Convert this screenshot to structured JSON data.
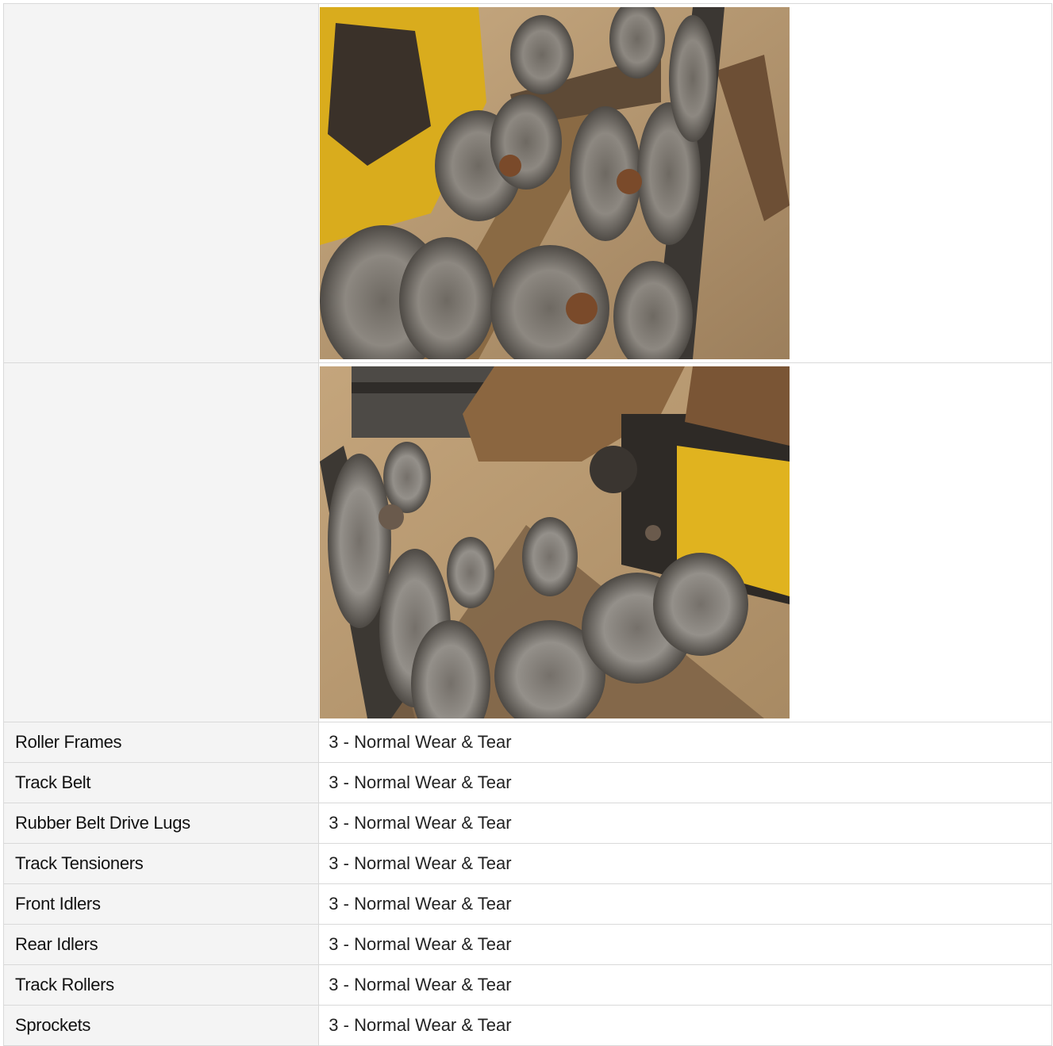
{
  "photos": [
    {
      "icon": "undercarriage-photo-roller-wheels-left"
    },
    {
      "icon": "undercarriage-photo-roller-wheels-right"
    }
  ],
  "rows": [
    {
      "label": "Roller Frames",
      "value": "3 - Normal Wear & Tear"
    },
    {
      "label": "Track Belt",
      "value": "3 - Normal Wear & Tear"
    },
    {
      "label": "Rubber Belt Drive Lugs",
      "value": "3 - Normal Wear & Tear"
    },
    {
      "label": "Track Tensioners",
      "value": "3 - Normal Wear & Tear"
    },
    {
      "label": "Front Idlers",
      "value": "3 - Normal Wear & Tear"
    },
    {
      "label": "Rear Idlers",
      "value": "3 - Normal Wear & Tear"
    },
    {
      "label": "Track Rollers",
      "value": "3 - Normal Wear & Tear"
    },
    {
      "label": "Sprockets",
      "value": "3 - Normal Wear & Tear"
    }
  ],
  "colors": {
    "label_bg": "#f4f4f4",
    "border": "#d9d9d9",
    "machine_yellow": "#e3b51c",
    "rust": "#7a5a3a",
    "dirt": "#b99a72"
  }
}
